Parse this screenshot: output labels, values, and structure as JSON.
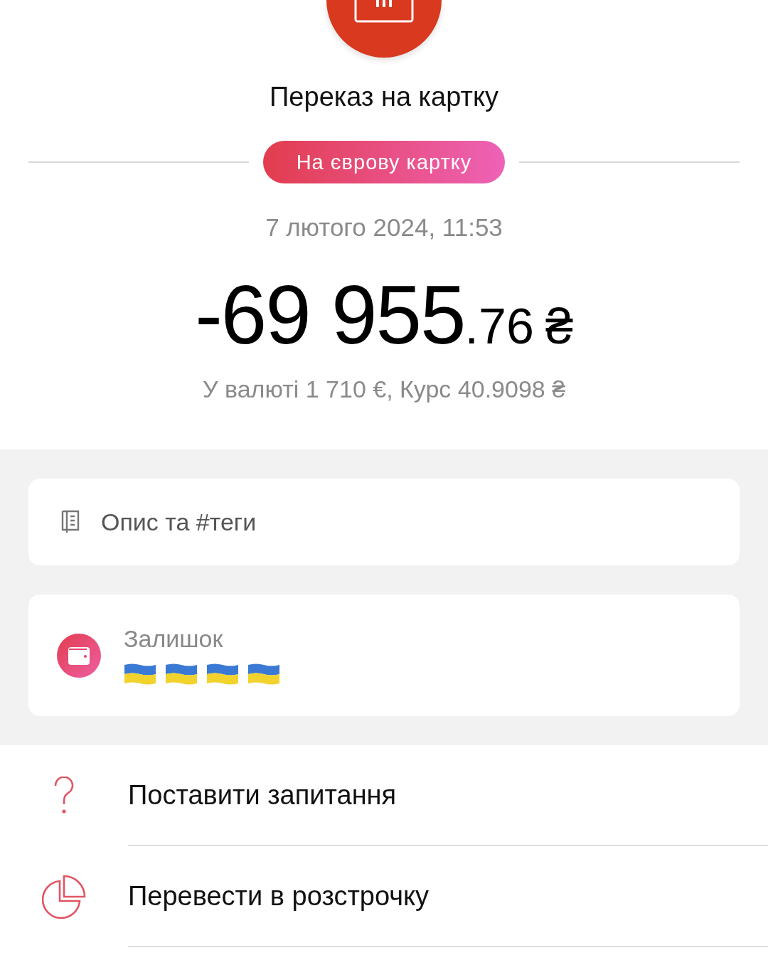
{
  "header": {
    "title": "Переказ на картку",
    "category": "На єврову картку",
    "date": "7 лютого 2024, 11:53"
  },
  "amount": {
    "main": "-69 955",
    "fraction": ".76",
    "currency": "₴",
    "details": "У валюті 1 710 €, Курс 40.9098 ₴"
  },
  "description": {
    "placeholder": "Опис та #теги"
  },
  "balance": {
    "label": "Залишок"
  },
  "actions": [
    {
      "kind": "question",
      "label": "Поставити запитання"
    },
    {
      "kind": "installment",
      "label": "Перевести в розстрочку"
    }
  ]
}
